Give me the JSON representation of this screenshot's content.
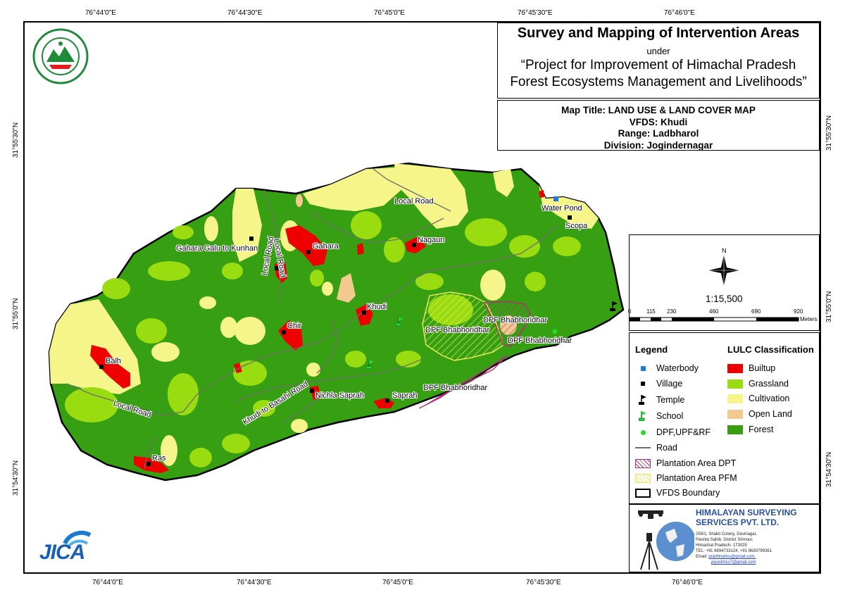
{
  "coords": {
    "top": [
      "76°44'0\"E",
      "76°44'30\"E",
      "76°45'0\"E",
      "76°45'30\"E",
      "76°46'0\"E"
    ],
    "bottom": [
      "76°44'0\"E",
      "76°44'30\"E",
      "76°45'0\"E",
      "76°45'30\"E",
      "76°46'0\"E"
    ],
    "left": [
      "31°55'30\"N",
      "31°55'0\"N",
      "31°54'30\"N"
    ],
    "right": [
      "31°55'30\"N",
      "31°55'0\"N",
      "31°54'30\"N"
    ]
  },
  "title": {
    "main": "Survey and Mapping of Intervention Areas",
    "under": "under",
    "project_line1": "“Project for Improvement of Himachal Pradesh",
    "project_line2": "Forest Ecosystems Management and Livelihoods”"
  },
  "info": {
    "map_title": "Map Title: LAND USE & LAND COVER MAP",
    "vfds": "VFDS: Khudi",
    "range": "Range: Ladbharol",
    "division": "Division: Jogindernagar"
  },
  "north": {
    "letter": "N",
    "scale": "1:15,500"
  },
  "scalebar": {
    "ticks": [
      "0",
      "115",
      "230",
      "460",
      "690",
      "920"
    ],
    "unit": "Meters"
  },
  "legend": {
    "heading": "Legend",
    "lulc_heading": "LULC Classification",
    "items": [
      "Waterbody",
      "Village",
      "Temple",
      "School",
      "DPF,UPF&RF",
      "Road",
      "Plantation Area DPT",
      "Plantation Area PFM",
      "VFDS Boundary"
    ],
    "lulc": [
      {
        "label": "Builtup",
        "color": "#ee0000"
      },
      {
        "label": "Grassland",
        "color": "#99dd11"
      },
      {
        "label": "Cultivation",
        "color": "#f5f58a"
      },
      {
        "label": "Open Land",
        "color": "#f2c98f"
      },
      {
        "label": "Forest",
        "color": "#37a012"
      }
    ]
  },
  "map_labels": {
    "local_road_top": "Local Road",
    "water_pond": "Water Pond",
    "scopa": "Scopa",
    "gahara_galu": "Gahara Galu to Kunhan",
    "local_road_v1": "Local Road",
    "local_road_v2": "Local Road",
    "gahara": "Gahara",
    "nagaun": "Nagaun",
    "khudi": "Khudi",
    "chir": "Chir",
    "balh": "Balh",
    "local_road_left": "Local Road",
    "khudi_basahi": "Khudi to Basahi Road",
    "nichla_saprah": "Nichla Saprah",
    "saprah": "Saprah",
    "ras": "Ras",
    "dpf1": "DPF Bhabhoridhar",
    "dpf2": "DPF Bhabhoridhar",
    "dpf3": "DPF Bhabhoridhar",
    "dpf4": "DPF Bhabhoridhar"
  },
  "company": {
    "name1": "HIMALAYAN SURVEYING",
    "name2": "SERVICES PVT. LTD.",
    "addr1": "259/1, Shakti Colony, Devinagar,",
    "addr2": "Paonta Sahib, District Sirmour,",
    "addr3": "Himachal Pradesh- 173025",
    "tel": "TEL: +91 8894733124, +91 8630799361",
    "email_label": "Email:",
    "email1": "prarthnahss@gmail.com,",
    "email2": "piyushhss7@gmail.com"
  },
  "logos": {
    "jica": "JICA",
    "forest_dept": "forest department emblem"
  }
}
